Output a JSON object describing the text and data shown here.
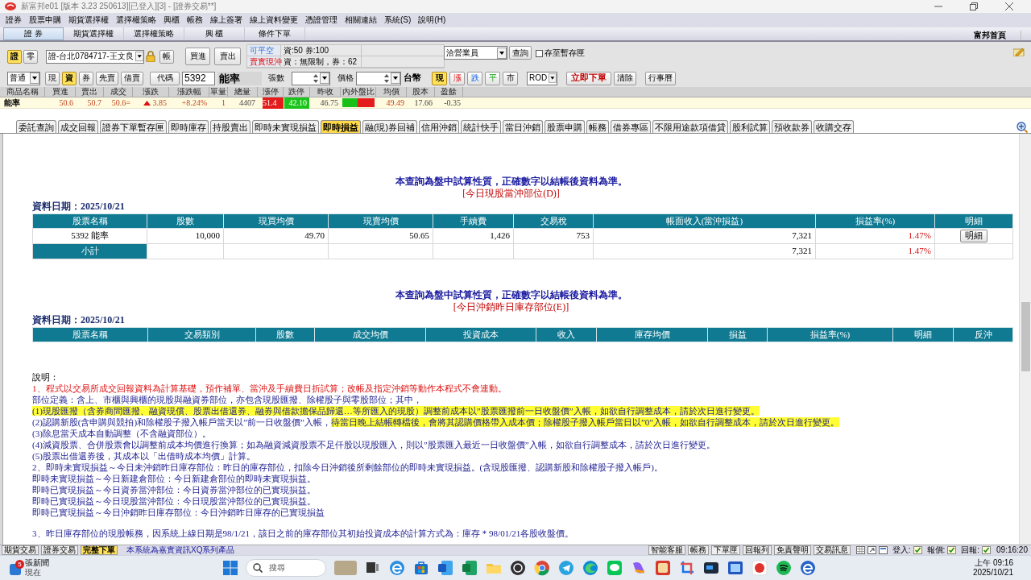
{
  "window": {
    "title": "新富邦e01 [版本 3.23 250613][已登入][3] - [證券交易**]"
  },
  "menu": [
    "證券",
    "股票申購",
    "期貨選擇權",
    "選擇權策略",
    "興櫃",
    "帳務",
    "線上簽署",
    "線上資料變更",
    "憑證管理",
    "相關連結",
    "系統(S)",
    "說明(H)"
  ],
  "main_tabs": [
    {
      "label": "證 券",
      "selected": true
    },
    {
      "label": "期貨選擇權",
      "selected": false
    },
    {
      "label": "選擇權策略",
      "selected": false
    },
    {
      "label": "興 櫃",
      "selected": false
    },
    {
      "label": "條件下單",
      "selected": false
    }
  ],
  "home_link": "富邦首頁",
  "order_panel": {
    "market_toggle": [
      {
        "label": "證",
        "selected": true
      },
      {
        "label": "零",
        "selected": false
      }
    ],
    "account": "證-台北0784717-王文良",
    "account_button": "帳",
    "buy_button": "買進",
    "sell_button": "賣出",
    "info": [
      {
        "label": "可平空",
        "kind": "short",
        "value": "資:50 券:100"
      },
      {
        "label": "賣實現沖",
        "kind": "day_trade",
        "value": "資：無限制，券：62"
      }
    ],
    "broker_select": "洽營業員",
    "query_button": "查詢",
    "save_to_queue": {
      "label": "存至暫存匣",
      "checked": false
    },
    "order_type_select": "普通",
    "credit_types": [
      {
        "label": "現",
        "selected": false
      },
      {
        "label": "資",
        "selected": true
      },
      {
        "label": "券",
        "selected": false
      },
      {
        "label": "先賣",
        "selected": false
      },
      {
        "label": "借賣",
        "selected": false
      }
    ],
    "code_button": "代碼",
    "code_value": "5392",
    "stock_name": "能率",
    "quantity_label": "張數",
    "price_label": "價格",
    "currency": "台幣",
    "price_types": [
      {
        "label": "現",
        "selected": true,
        "kind": "spot"
      },
      {
        "label": "漲",
        "selected": false,
        "kind": "limit_up"
      },
      {
        "label": "跌",
        "selected": false,
        "kind": "limit_down"
      },
      {
        "label": "平",
        "selected": false,
        "kind": "flat"
      },
      {
        "label": "市",
        "selected": false,
        "kind": "market"
      }
    ],
    "time_in_force": "ROD",
    "submit_button": "立即下單",
    "clear_button": "清除",
    "calendar_button": "行事曆"
  },
  "quote": {
    "columns": [
      "商品名稱",
      "買進",
      "賣出",
      "成交",
      "漲跌",
      "漲跌幅",
      "單量",
      "總量",
      "漲停",
      "跌停",
      "昨收",
      "內外盤比",
      "均價",
      "股本",
      "盈餘"
    ],
    "row": [
      {
        "kind": "name",
        "text": "能率"
      },
      {
        "kind": "up",
        "text": "50.6"
      },
      {
        "kind": "up",
        "text": "50.7"
      },
      {
        "kind": "up",
        "text": "50.6="
      },
      {
        "kind": "change_up",
        "text": "3.85"
      },
      {
        "kind": "up",
        "text": "+8.24%"
      },
      {
        "kind": "up",
        "text": "1"
      },
      {
        "kind": "plain",
        "text": "4407"
      },
      {
        "kind": "limit_up",
        "text": "51.4"
      },
      {
        "kind": "limit_down",
        "text": "42.10"
      },
      {
        "kind": "plain",
        "text": "46.75"
      },
      {
        "kind": "ratio",
        "level": 0.47
      },
      {
        "kind": "up",
        "text": "49.49"
      },
      {
        "kind": "plain",
        "text": "17.66"
      },
      {
        "kind": "plain",
        "text": "-0.35"
      }
    ]
  },
  "sub_tabs": [
    {
      "label": "委託查詢",
      "selected": false
    },
    {
      "label": "成交回報",
      "selected": false
    },
    {
      "label": "證券下單暫存匣",
      "selected": false
    },
    {
      "label": "即時庫存",
      "selected": false
    },
    {
      "label": "持股賣出",
      "selected": false
    },
    {
      "label": "即時未實現損益",
      "selected": false
    },
    {
      "label": "即時損益",
      "selected": true
    },
    {
      "label": "融(現)券回補",
      "selected": false
    },
    {
      "label": "信用沖銷",
      "selected": false
    },
    {
      "label": "統計快手",
      "selected": false
    },
    {
      "label": "當日沖銷",
      "selected": false
    },
    {
      "label": "股票申購",
      "selected": false
    },
    {
      "label": "帳務",
      "selected": false
    },
    {
      "label": "借券專區",
      "selected": false
    },
    {
      "label": "不限用途款項借貸",
      "selected": false
    },
    {
      "label": "股利試算",
      "selected": false
    },
    {
      "label": "預收款券",
      "selected": false
    },
    {
      "label": "收購交存",
      "selected": false
    }
  ],
  "sections": [
    {
      "notice": "本查詢為盤中試算性質，正確數字以結帳後資料為準。",
      "title": "[今日現股當沖部位(D)]",
      "date": "資料日期：2025/10/21",
      "columns": [
        "股票名稱",
        "股數",
        "現買均價",
        "現賣均價",
        "手續費",
        "交易稅",
        "帳面收入(當沖損益)",
        "損益率(%)",
        "明細"
      ],
      "rows": [
        {
          "kind": "position",
          "stock": "5392 能率",
          "shares": "10,000",
          "buy_avg": "49.70",
          "sell_avg": "50.65",
          "fee": "1,426",
          "tax": "753",
          "income": "7,321",
          "rate": "1.47%",
          "detail_button": "明細"
        },
        {
          "kind": "subtotal",
          "label": "小計",
          "income": "7,321",
          "rate": "1.47%"
        }
      ]
    },
    {
      "notice": "本查詢為盤中試算性質，正確數字以結帳後資料為準。",
      "title": "[今日沖銷昨日庫存部位(E)]",
      "date": "資料日期：2025/10/21",
      "columns": [
        "股票名稱",
        "交易類別",
        "股數",
        "成交均價",
        "投資成本",
        "收入",
        "庫存均價",
        "損益",
        "損益率(%)",
        "明細",
        "反沖"
      ]
    }
  ],
  "notes": {
    "heading": "說明：",
    "blocks": [
      {
        "lines": [
          {
            "kind": "warning",
            "segments": [
              {
                "text": "1、程式以交易所成交回報資料為計算基礎，預作補單、當沖及手續費日折試算；改帳及指定沖銷等動作本程式不會連動。",
                "highlighted": false
              }
            ]
          },
          {
            "kind": "plain",
            "segments": [
              {
                "text": "部位定義：含上、市櫃與興櫃的現股與融資券部位，亦包含現股匯撥、除權股子與零股部位；其中，",
                "highlighted": false
              }
            ]
          },
          {
            "kind": "plain",
            "segments": [
              {
                "text": "(1)現股匯撥（含券商間匯撥、融資現償、股票出借還券、融券與借款擔保品歸還…等所匯入的現股）調整前成本以”股票匯撥前一日收盤價”入帳，如欲自行調整成本，請於次日進行變更。",
                "highlighted": true
              }
            ]
          },
          {
            "kind": "plain",
            "segments": [
              {
                "text": "(2)認購新股(含申購與競拍)和除權股子撥入帳戶當天以”前一日收盤價”入帳，",
                "highlighted": false
              },
              {
                "text": "待當日晚上結帳轉檔後，會將其認購價格帶入成本價；除權股子撥入帳戶當日以”0”入帳，如欲自行調整成本，請於次日進行變更。",
                "highlighted": true
              }
            ]
          },
          {
            "kind": "plain",
            "segments": [
              {
                "text": "(3)除息當天成本自動調整（不含融資部位）。",
                "highlighted": false
              }
            ]
          },
          {
            "kind": "plain",
            "segments": [
              {
                "text": "(4)減資股票、合併股票會以調整前成本均價進行換算；如為融資減資股票不足仟股以現股匯入，則以”股票匯入最近一日收盤價”入帳，如欲自行調整成本，請於次日進行變更。",
                "highlighted": false
              }
            ]
          },
          {
            "kind": "plain",
            "segments": [
              {
                "text": "(5)股票出借還券後，其成本以「出借時成本均價」計算。",
                "highlighted": false
              }
            ]
          },
          {
            "kind": "plain",
            "segments": [
              {
                "text": "2、即時未實現損益～今日未沖銷昨日庫存部位：昨日的庫存部位，扣除今日沖銷後所剩餘部位的即時未實現損益。(含現股匯撥、認購新股和除權股子撥入帳戶)。",
                "highlighted": false
              }
            ]
          },
          {
            "kind": "plain",
            "segments": [
              {
                "text": "即時未實現損益～今日新建倉部位：今日新建倉部位的即時未實現損益。",
                "highlighted": false
              }
            ]
          },
          {
            "kind": "plain",
            "segments": [
              {
                "text": "即時已實現損益～今日資券當沖部位：今日資券當沖部位的已實現損益。",
                "highlighted": false
              }
            ]
          },
          {
            "kind": "plain",
            "segments": [
              {
                "text": "即時已實現損益～今日現股當沖部位：今日現股當沖部位的已實現損益。",
                "highlighted": false
              }
            ]
          },
          {
            "kind": "plain",
            "segments": [
              {
                "text": "即時已實現損益～今日沖銷昨日庫存部位：今日沖銷昨日庫存的已實現損益",
                "highlighted": false
              }
            ]
          }
        ]
      },
      {
        "lines": [
          {
            "kind": "plain",
            "segments": [
              {
                "text": "3、昨日庫存部位的現股帳務，因系統上線日期是98/1/21，該日之前的庫存部位其初始投資成本的計算方式為：庫存＊98/01/21各股收盤價。",
                "highlighted": false
              }
            ]
          }
        ]
      }
    ]
  },
  "status_bar": {
    "tabs": [
      {
        "label": "期貨交易",
        "selected": false
      },
      {
        "label": "證券交易",
        "selected": false
      },
      {
        "label": "完整下單",
        "selected": true
      }
    ],
    "product_note": "本系統為嘉實資訊XQ系列產品",
    "buttons": [
      "智能客服",
      "帳務",
      "下單匣",
      "回報列",
      "免責聲明",
      "交易訊息"
    ],
    "connections": [
      {
        "label": "登入:",
        "on": true
      },
      {
        "label": "報價:",
        "on": true
      },
      {
        "label": "回報:",
        "on": true
      }
    ],
    "clock": "09:16:20"
  },
  "taskbar": {
    "news": {
      "badge": "5",
      "title": "張新聞",
      "subtitle": "現在"
    },
    "search_placeholder": "搜尋",
    "time": "上午 09:16",
    "date": "2025/10/21"
  }
}
